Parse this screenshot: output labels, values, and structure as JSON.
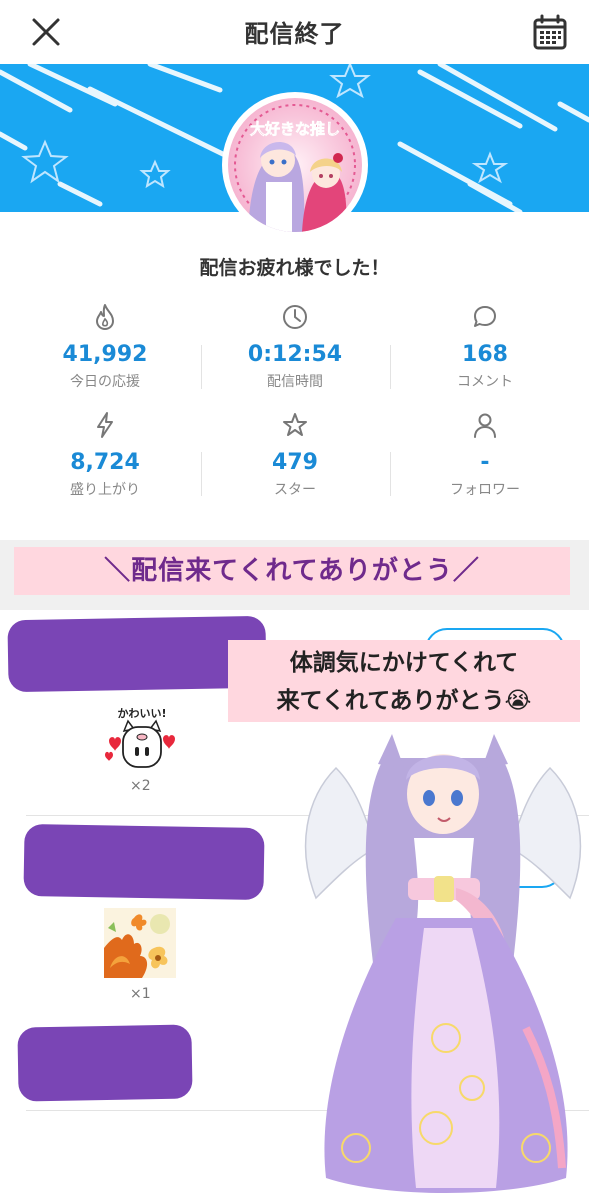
{
  "header": {
    "title": "配信終了"
  },
  "message": "配信お疲れ様でした！",
  "avatar_text": "大好きな推し",
  "stats": [
    {
      "value": "41,992",
      "label": "今日の応援",
      "icon": "flame-icon"
    },
    {
      "value": "0:12:54",
      "label": "配信時間",
      "icon": "clock-icon"
    },
    {
      "value": "168",
      "label": "コメント",
      "icon": "comment-icon"
    },
    {
      "value": "8,724",
      "label": "盛り上がり",
      "icon": "lightning-icon"
    },
    {
      "value": "479",
      "label": "スター",
      "icon": "star-icon"
    },
    {
      "value": "-",
      "label": "フォロワー",
      "icon": "person-icon"
    }
  ],
  "caption": "＼配信来てくれてありがとう／",
  "note": {
    "line1": "体調気にかけてくれて",
    "line2": "来てくれてありがとう😭"
  },
  "supporters": [
    {
      "gift_label": "かわいい!",
      "gift_icon": "kawaii-cat-gift-icon",
      "count": "×2"
    },
    {
      "gift_icon": "flower-gift-icon",
      "count": "×1"
    }
  ],
  "colors": {
    "accent": "#1a8ad6",
    "banner": "#1aa7f2",
    "caption_bg": "#ffd7df",
    "caption_text": "#6f2a8c",
    "redaction": "#7a45b5"
  }
}
